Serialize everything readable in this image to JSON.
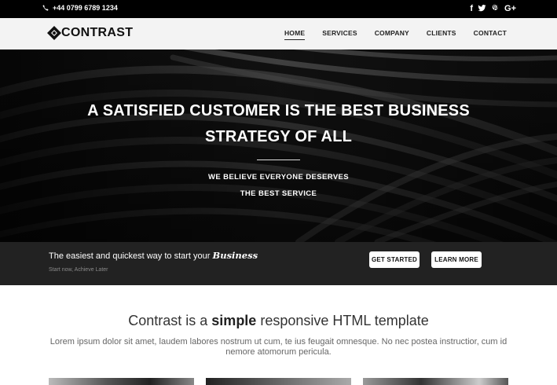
{
  "topbar": {
    "phone": "+44 0799 6789 1234",
    "social_icons": [
      "facebook-icon",
      "twitter-icon",
      "pinterest-icon",
      "google-plus-icon"
    ],
    "social_labels": {
      "facebook": "f",
      "google_plus": "G+"
    }
  },
  "navbar": {
    "brand": "CONTRAST",
    "menu": [
      {
        "label": "HOME",
        "active": true
      },
      {
        "label": "SERVICES",
        "active": false
      },
      {
        "label": "COMPANY",
        "active": false
      },
      {
        "label": "CLIENTS",
        "active": false
      },
      {
        "label": "CONTACT",
        "active": false
      }
    ]
  },
  "hero": {
    "headline_line1": "A SATISFIED CUSTOMER IS THE BEST BUSINESS",
    "headline_line2": "STRATEGY OF ALL",
    "sub_line1": "WE BELIEVE EVERYONE DESERVES",
    "sub_line2": "THE BEST SERVICE"
  },
  "cta": {
    "text": "The easiest and quickest way to start your",
    "text_emphasis": "Business",
    "small": "Start now, Achieve Later",
    "get_started": "GET STARTED",
    "learn_more": "LEARN MORE"
  },
  "intro": {
    "title_before": "Contrast is a",
    "title_bold": "simple",
    "title_after": "responsive HTML template",
    "text": "Lorem ipsum dolor sit amet, laudem labores nostrum ut cum, te ius feugait omnesque. No nec postea instructior, cum id nemore atomorum pericula."
  },
  "colors": {
    "topbar_bg": "#000000",
    "navbar_bg": "#f3f3f3",
    "cta_bg": "#222222",
    "button_bg": "#ffffff"
  }
}
